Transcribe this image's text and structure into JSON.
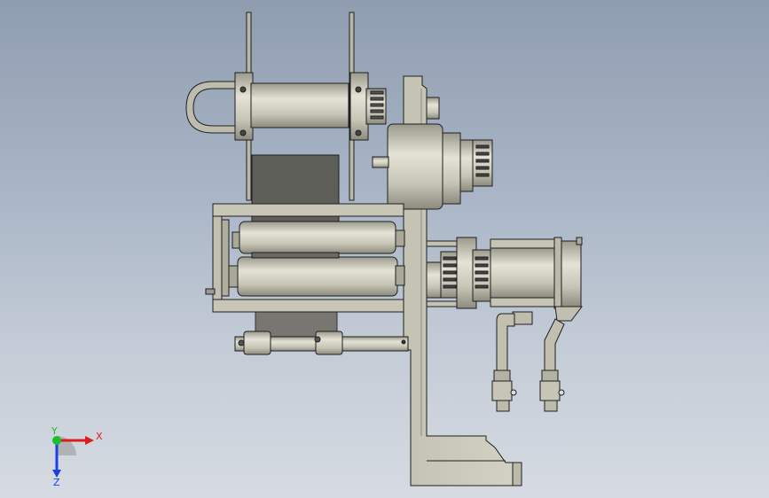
{
  "viewport": {
    "background_top": "#8f9db0",
    "background_bottom": "#d6dbe2",
    "model_fill": "#c9c8b8",
    "model_shadow": "#a3a293",
    "model_dark": "#5b5b55",
    "edge_color": "#1f1f1f"
  },
  "triad": {
    "x_label": "X",
    "y_label": "Y",
    "z_label": "Z",
    "x_color": "#e01b1b",
    "y_color": "#1bbf2a",
    "z_color": "#1b3fe0"
  }
}
